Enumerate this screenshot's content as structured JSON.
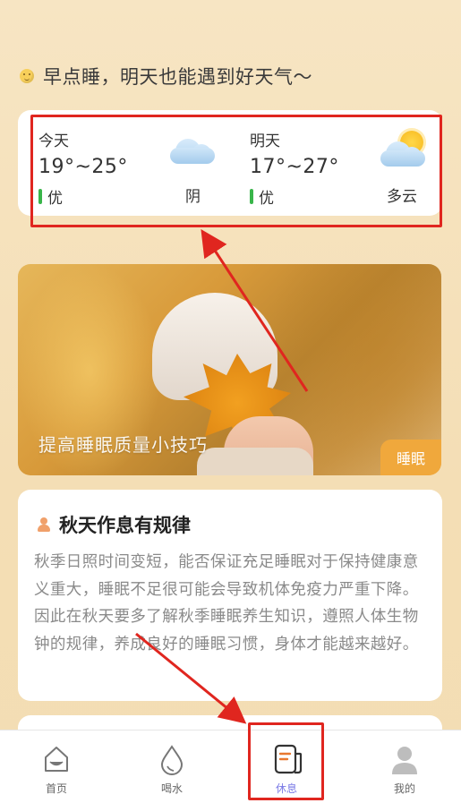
{
  "greeting": {
    "text": "早点睡，明天也能遇到好天气～",
    "icon": "smile-emoji-icon"
  },
  "weather": {
    "today": {
      "label": "今天",
      "temp": "19°~25°",
      "air_quality": "优",
      "condition": "阴",
      "icon": "cloudy-icon"
    },
    "tomorrow": {
      "label": "明天",
      "temp": "17°~27°",
      "air_quality": "优",
      "condition": "多云",
      "icon": "partly-cloudy-icon"
    }
  },
  "banner": {
    "title": "提高睡眠质量小技巧",
    "tag": "睡眠"
  },
  "article": {
    "title": "秋天作息有规律",
    "body": "秋季日照时间变短，能否保证充足睡眠对于保持健康意义重大，睡眠不足很可能会导致机体免疫力严重下降。因此在秋天要多了解秋季睡眠养生知识，遵照人体生物钟的规律，养成良好的睡眠习惯，身体才能越来越好。"
  },
  "tabbar": {
    "tabs": [
      {
        "label": "首页",
        "icon": "home-icon",
        "active": false
      },
      {
        "label": "喝水",
        "icon": "water-drop-icon",
        "active": false
      },
      {
        "label": "休息",
        "icon": "rest-note-icon",
        "active": true
      },
      {
        "label": "我的",
        "icon": "user-icon",
        "active": false
      }
    ]
  },
  "colors": {
    "accent": "#7b7be6",
    "highlight": "#e0261f",
    "good_air": "#39b54a",
    "tag_bg": "#f0a83c",
    "page_bg": "#f6e2be"
  }
}
